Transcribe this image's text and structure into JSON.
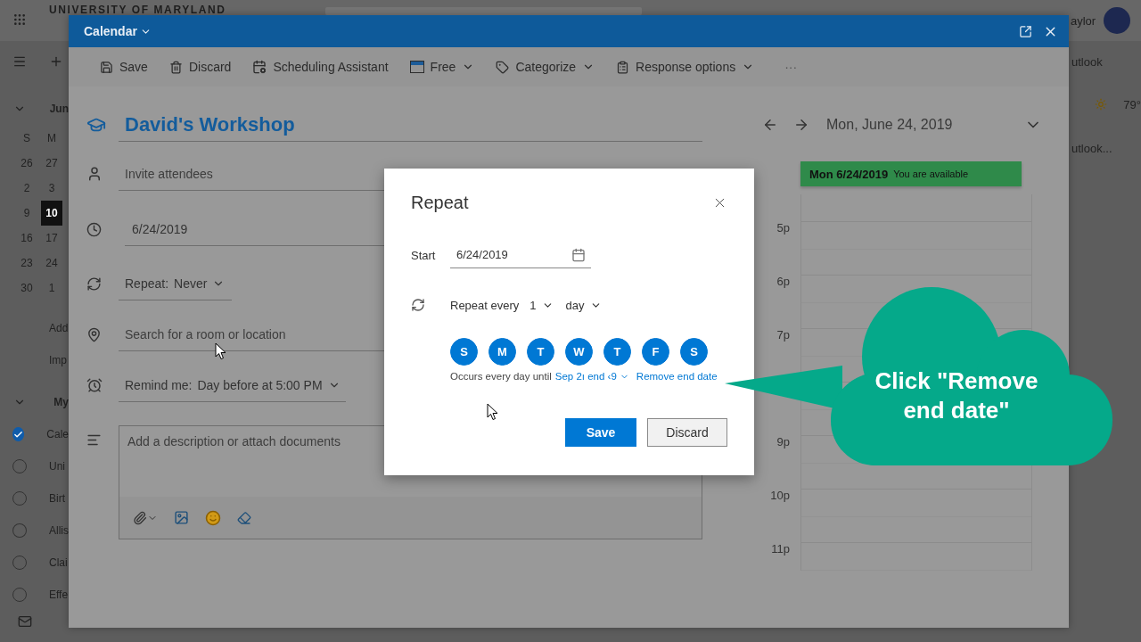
{
  "app_header": {
    "org": "UNIVERSITY OF MARYLAND",
    "user": "aylor"
  },
  "left_nav": {
    "month": "Jun",
    "weekdays": [
      "S",
      "M"
    ],
    "weeks": [
      [
        {
          "day": "26",
          "selected": false
        },
        {
          "day": "27",
          "selected": false
        }
      ],
      [
        {
          "day": "2",
          "selected": false
        },
        {
          "day": "3",
          "selected": false
        }
      ],
      [
        {
          "day": "9",
          "selected": false
        },
        {
          "day": "10",
          "selected": true
        }
      ],
      [
        {
          "day": "16",
          "selected": false
        },
        {
          "day": "17",
          "selected": false
        }
      ],
      [
        {
          "day": "23",
          "selected": false
        },
        {
          "day": "24",
          "selected": false
        }
      ],
      [
        {
          "day": "30",
          "selected": false
        },
        {
          "day": "1",
          "selected": false
        }
      ]
    ],
    "links": [
      "Add",
      "Imp"
    ],
    "group": "My",
    "calendars": [
      {
        "name": "Cale",
        "checked": true
      },
      {
        "name": "Uni",
        "checked": false
      },
      {
        "name": "Birt",
        "checked": false
      },
      {
        "name": "Allis",
        "checked": false
      },
      {
        "name": "Clai",
        "checked": false
      },
      {
        "name": "Effe",
        "checked": false
      }
    ]
  },
  "right_strip": {
    "top_item": "utlook",
    "weather": "79°",
    "item": "utlook..."
  },
  "event_window": {
    "title": "Calendar",
    "toolbar": [
      {
        "kind": "save",
        "label": "Save",
        "dropdown": false
      },
      {
        "kind": "discard",
        "label": "Discard",
        "dropdown": false
      },
      {
        "kind": "schedule",
        "label": "Scheduling Assistant",
        "dropdown": false
      },
      {
        "kind": "free",
        "label": "Free",
        "dropdown": true
      },
      {
        "kind": "categorize",
        "label": "Categorize",
        "dropdown": true
      },
      {
        "kind": "response",
        "label": "Response options",
        "dropdown": true
      }
    ],
    "more": "···",
    "event_title": "David's Workshop",
    "attendees": {
      "placeholder": "Invite attendees"
    },
    "date": "6/24/2019",
    "repeat": {
      "label": "Repeat:",
      "value": "Never"
    },
    "location": {
      "placeholder": "Search for a room or location"
    },
    "reminder": {
      "label": "Remind me:",
      "value": "Day before at 5:00 PM"
    },
    "description": {
      "placeholder": "Add a description or attach documents"
    },
    "day_view": {
      "date": "Mon, June 24, 2019",
      "banner_date": "Mon 6/24/2019",
      "banner_status": "You are available",
      "hours": [
        {
          "kind": "label",
          "label": "5p"
        },
        {
          "kind": "label",
          "label": "6p"
        },
        {
          "kind": "label",
          "label": "7p"
        },
        {
          "kind": "covered"
        },
        {
          "kind": "label",
          "label": "9p"
        },
        {
          "kind": "label",
          "label": "10p"
        },
        {
          "kind": "label",
          "label": "11p"
        }
      ]
    }
  },
  "repeat_dialog": {
    "title": "Repeat",
    "start_label": "Start",
    "start_date": "6/24/2019",
    "repeat_label": "Repeat every",
    "interval": "1",
    "unit": "day",
    "days": [
      {
        "letter": "S",
        "selected": true
      },
      {
        "letter": "M",
        "selected": true
      },
      {
        "letter": "T",
        "selected": true
      },
      {
        "letter": "W",
        "selected": true
      },
      {
        "letter": "T",
        "selected": true
      },
      {
        "letter": "F",
        "selected": true
      },
      {
        "letter": "S",
        "selected": true
      }
    ],
    "summary": "Occurs every day until",
    "end_date": "Sep 2ı end ‹9",
    "remove_link": "Remove end date",
    "buttons": [
      {
        "label": "Save",
        "primary": true
      },
      {
        "label": "Discard",
        "primary": false
      }
    ]
  },
  "callout": {
    "text": "Click \"Remove end date\""
  }
}
